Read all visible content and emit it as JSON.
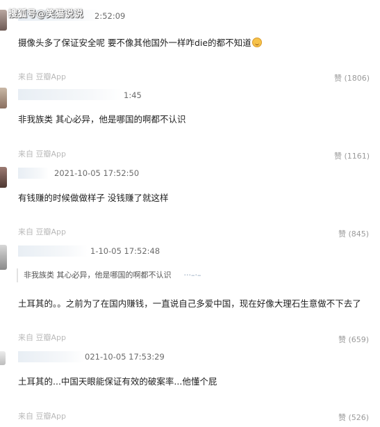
{
  "watermark": "搜狐号@笑猫说说",
  "comments": [
    {
      "time": "2:52:09",
      "text": "摄像头多了保证安全呢 要不像其他国外一样咋die的都不知道",
      "emoji": "smile-emoji",
      "source": "来自 豆瓣App",
      "likes": "赞 (1806)"
    },
    {
      "time": "1:45",
      "text": "非我族类 其心必异，他是哪国的啊都不认识",
      "source": "来自 豆瓣App",
      "likes": "赞 (1161)"
    },
    {
      "time": "2021-10-05 17:52:50",
      "text": "有钱赚的时候做做样子 没钱赚了就这样",
      "source": "来自 豆瓣App",
      "likes": "赞 (845)"
    },
    {
      "time": "1-10-05 17:52:48",
      "quote": "非我族类 其心必异，他是哪国的啊都不认识",
      "text": "土耳其的。。之前为了在国内赚钱，一直说自己多爱中国，现在好像大理石生意做不下去了",
      "source": "来自 豆瓣App",
      "likes": "赞 (659)"
    },
    {
      "time": "021-10-05 17:53:29",
      "text": "土耳其的...中国天眼能保证有效的破案率...他懂个屁",
      "source": "来自 豆瓣App",
      "likes": "赞 (526)"
    }
  ]
}
